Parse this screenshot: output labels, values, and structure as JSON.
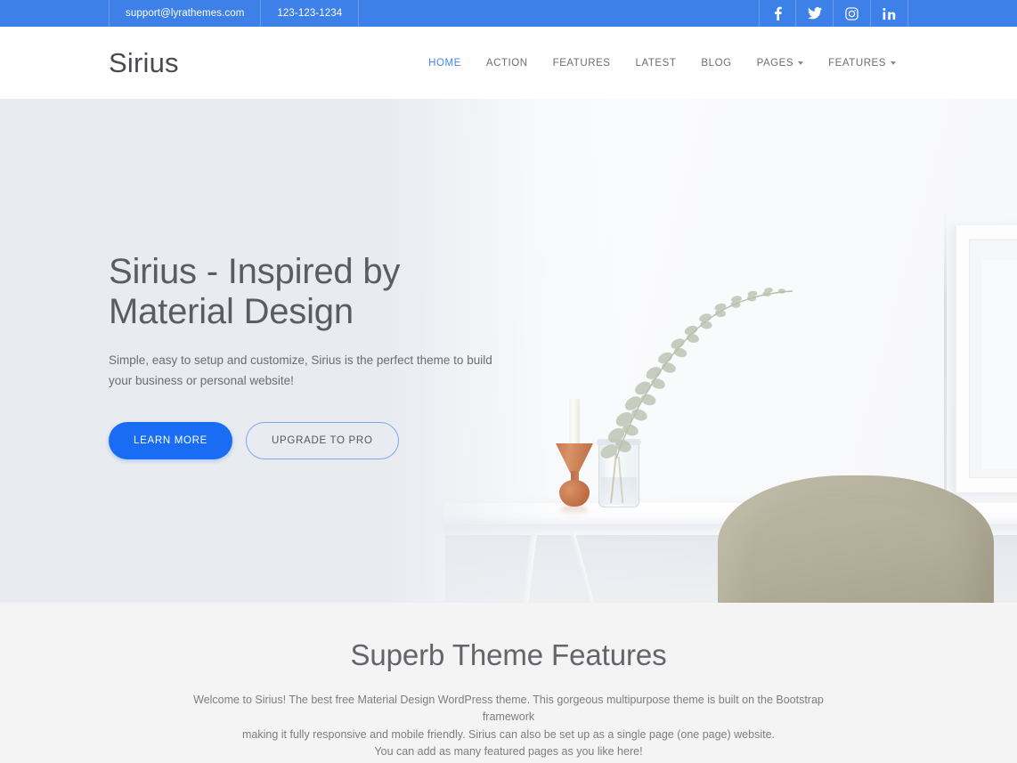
{
  "topbar": {
    "email": "support@lyrathemes.com",
    "phone": "123-123-1234",
    "socials": [
      {
        "name": "facebook-icon",
        "label": "Facebook"
      },
      {
        "name": "twitter-icon",
        "label": "Twitter"
      },
      {
        "name": "instagram-icon",
        "label": "Instagram"
      },
      {
        "name": "linkedin-icon",
        "label": "LinkedIn"
      }
    ],
    "bg_color": "#3d80e8"
  },
  "header": {
    "logo": "Sirius",
    "nav": [
      {
        "label": "HOME",
        "active": true,
        "caret": false
      },
      {
        "label": "ACTION",
        "active": false,
        "caret": false
      },
      {
        "label": "FEATURES",
        "active": false,
        "caret": false
      },
      {
        "label": "LATEST",
        "active": false,
        "caret": false
      },
      {
        "label": "BLOG",
        "active": false,
        "caret": false
      },
      {
        "label": "PAGES",
        "active": false,
        "caret": true
      },
      {
        "label": "FEATURES",
        "active": false,
        "caret": true
      }
    ],
    "active_color": "#4285f4"
  },
  "hero": {
    "title": "Sirius - Inspired by Material Design",
    "subtitle": "Simple, easy to setup and customize, Sirius is the perfect theme to build your business or personal website!",
    "primary_button": "LEARN MORE",
    "secondary_button": "UPGRADE TO PRO",
    "primary_color": "#1a6cf5",
    "background_color": "#e8ebf0"
  },
  "features": {
    "title": "Superb Theme Features",
    "line1": "Welcome to Sirius! The best free Material Design WordPress theme. This gorgeous multipurpose theme is built on the Bootstrap framework",
    "line2": "making it fully responsive and mobile friendly. Sirius can also be set up as a single page (one page) website.",
    "line3": "You can add as many featured pages as you like here!",
    "background_color": "#f4f4f4"
  }
}
